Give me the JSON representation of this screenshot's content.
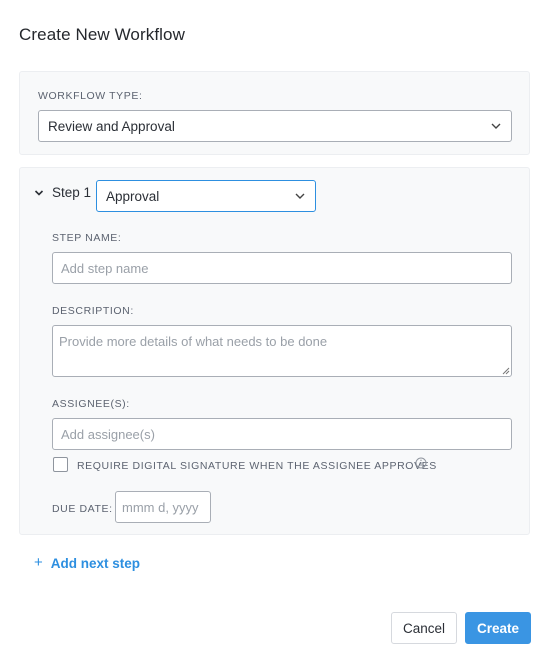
{
  "dialog": {
    "title": "Create New Workflow"
  },
  "workflow_type": {
    "label": "WORKFLOW TYPE:",
    "value": "Review and Approval",
    "icon": "chevron-down-icon"
  },
  "step": {
    "label": "Step 1",
    "type_value": "Approval",
    "toggle_icon": "chevron-down-icon",
    "name_label": "STEP NAME:",
    "name_placeholder": "Add step name",
    "description_label": "DESCRIPTION:",
    "description_placeholder": "Provide more details of what needs to be done",
    "assignees_label": "ASSIGNEE(S):",
    "assignees_placeholder": "Add assignee(s)",
    "signature_label": "REQUIRE DIGITAL SIGNATURE WHEN THE ASSIGNEE APPROVES",
    "signature_checked": false,
    "info_icon": "info-icon",
    "due_date_label": "DUE DATE:",
    "due_date_placeholder": "mmm d, yyyy"
  },
  "add_next_step": {
    "icon": "+",
    "label": "Add next step"
  },
  "footer": {
    "cancel_label": "Cancel",
    "create_label": "Create"
  },
  "colors": {
    "accent": "#3a95e3",
    "link": "#2d8fe0",
    "panel_bg": "#f8f9fa"
  }
}
